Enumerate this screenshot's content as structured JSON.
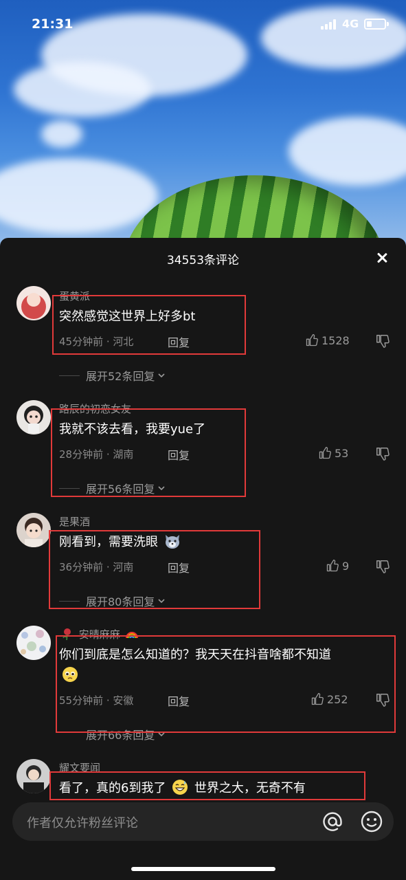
{
  "status_bar": {
    "time": "21:31",
    "network": "4G",
    "battery_level": 0.3
  },
  "panel": {
    "title": "34553条评论",
    "close_icon": "close-icon"
  },
  "comments": [
    {
      "username": "蛋黄派",
      "text": "突然感觉这世界上好多bt",
      "meta": "45分钟前 · 河北",
      "reply_label": "回复",
      "likes": "1528",
      "expand_label": "展开52条回复"
    },
    {
      "username": "路辰的初恋女友",
      "text": "我就不该去看，我要yue了",
      "meta": "28分钟前 · 湖南",
      "reply_label": "回复",
      "likes": "53",
      "expand_label": "展开56条回复"
    },
    {
      "username": "是果酒",
      "text": "刚看到，需要洗眼",
      "meta": "36分钟前 · 河南",
      "reply_label": "回复",
      "likes": "9",
      "expand_label": "展开80条回复"
    },
    {
      "username": "安晴麻麻",
      "text": "你们到底是怎么知道的？我天天在抖音啥都不知道",
      "meta": "55分钟前 · 安徽",
      "reply_label": "回复",
      "likes": "252",
      "expand_label": "展开66条回复"
    },
    {
      "username": "耀文要闻",
      "text_before": "看了，真的6到我了",
      "text_after": "世界之大，无奇不有"
    }
  ],
  "input": {
    "placeholder": "作者仅允许粉丝评论",
    "at_icon": "at-icon",
    "emoji_icon": "emoji-icon"
  },
  "colors": {
    "highlight": "#e23a3a",
    "panel_bg": "#161616",
    "input_bg": "#252525"
  }
}
